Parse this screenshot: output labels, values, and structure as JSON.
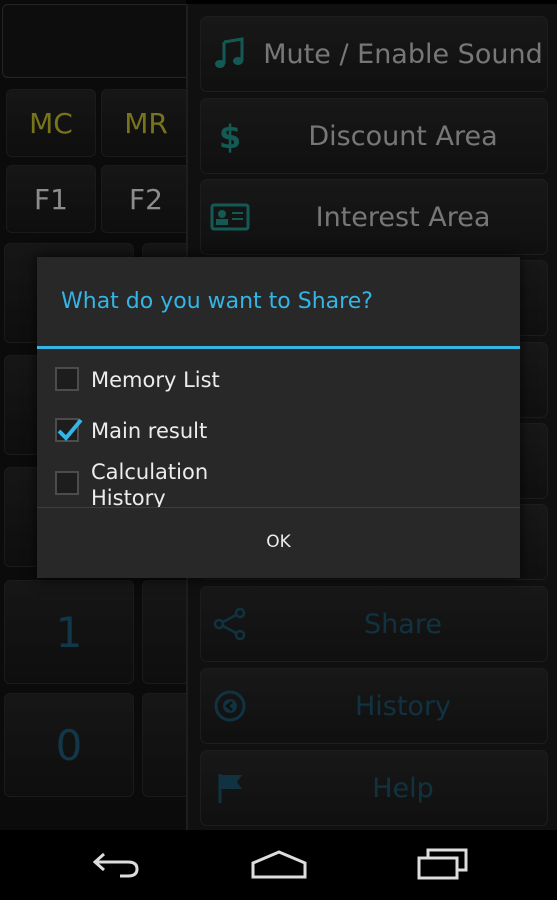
{
  "calculator": {
    "memory_keys": [
      "MC",
      "MR"
    ],
    "function_keys": [
      "F1",
      "F2"
    ],
    "digit_keys": [
      "1",
      "0"
    ]
  },
  "menu": {
    "items": [
      {
        "label": "Mute / Enable Sound",
        "icon": "music-note-icon"
      },
      {
        "label": "Discount Area",
        "icon": "dollar-icon"
      },
      {
        "label": "Interest Area",
        "icon": "id-card-icon"
      },
      {
        "label": "Share",
        "icon": "share-icon"
      },
      {
        "label": "History",
        "icon": "history-icon"
      },
      {
        "label": "Help",
        "icon": "flag-icon"
      }
    ]
  },
  "dialog": {
    "title": "What do you want to Share?",
    "options": [
      {
        "label": "Memory List",
        "checked": false
      },
      {
        "label": "Main result",
        "checked": true
      },
      {
        "label": "Calculation History",
        "checked": false
      }
    ],
    "ok_label": "OK"
  },
  "navbar": {
    "buttons": [
      "back-icon",
      "home-icon",
      "recent-apps-icon"
    ]
  },
  "colors": {
    "accent": "#33b5e5",
    "memory_key": "#b8b32a",
    "dim_digit": "#1c5570"
  }
}
